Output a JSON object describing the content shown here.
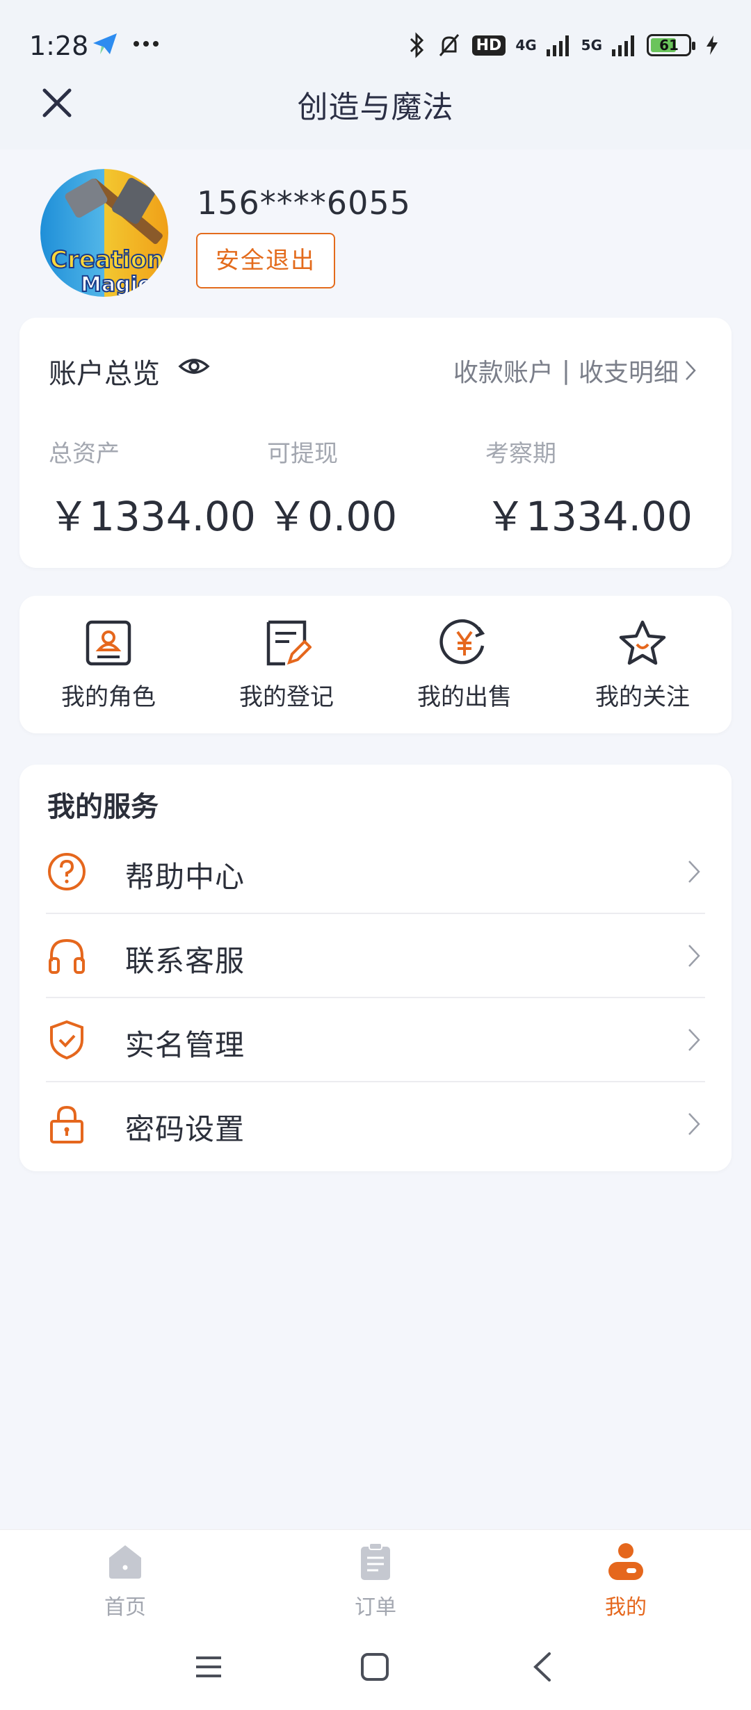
{
  "status_bar": {
    "time": "1:28",
    "hd_label": "HD",
    "net1": "4G",
    "net2": "5G",
    "battery": "61"
  },
  "header": {
    "title": "创造与魔法"
  },
  "profile": {
    "phone": "156****6055",
    "logout_label": "安全退出",
    "avatar_text_1": "Creation",
    "avatar_text_2": "Magic"
  },
  "overview": {
    "title": "账户总览",
    "link_receive": "收款账户",
    "link_separator": "|",
    "link_details": "收支明细",
    "assets": [
      {
        "label": "总资产",
        "value": "￥1334.00"
      },
      {
        "label": "可提现",
        "value": "￥0.00"
      },
      {
        "label": "考察期",
        "value": "￥1334.00"
      }
    ]
  },
  "shortcuts": [
    {
      "label": "我的角色",
      "icon": "role-icon"
    },
    {
      "label": "我的登记",
      "icon": "register-icon"
    },
    {
      "label": "我的出售",
      "icon": "sell-icon"
    },
    {
      "label": "我的关注",
      "icon": "star-icon"
    }
  ],
  "services": {
    "title": "我的服务",
    "items": [
      {
        "label": "帮助中心",
        "icon": "help-icon"
      },
      {
        "label": "联系客服",
        "icon": "headset-icon"
      },
      {
        "label": "实名管理",
        "icon": "shield-icon"
      },
      {
        "label": "密码设置",
        "icon": "lock-icon"
      }
    ]
  },
  "tabbar": {
    "items": [
      {
        "label": "首页",
        "icon": "home-icon",
        "active": false
      },
      {
        "label": "订单",
        "icon": "orders-icon",
        "active": false
      },
      {
        "label": "我的",
        "icon": "profile-icon",
        "active": true
      }
    ]
  },
  "colors": {
    "accent": "#e5671d",
    "icon_dark": "#2b2f3a",
    "background": "#f4f6fb"
  }
}
